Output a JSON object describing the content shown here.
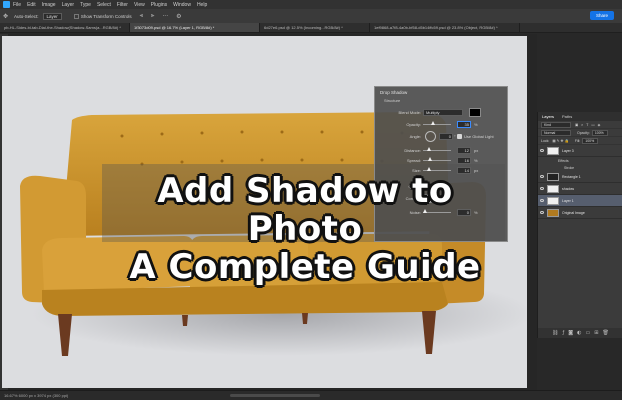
{
  "menubar": {
    "items": [
      "File",
      "Edit",
      "Image",
      "Layer",
      "Type",
      "Select",
      "Filter",
      "View",
      "Plugins",
      "Window",
      "Help"
    ]
  },
  "options": {
    "auto_select_label": "Auto-Select:",
    "auto_select_value": "Layer",
    "transform_label": "Show Transform Controls",
    "share_label": "Share"
  },
  "tabs": [
    {
      "label": "pb-HL-Sides-bl-tab-Dial-the-Shadow(Shadow-Sams)a...RGB/8#) *"
    },
    {
      "label": "1f3073d09.psd @ 16.7% (Layer 1, RGB/8#) *"
    },
    {
      "label": "6d27e6.psd @ 12.5% (Incoming...RGB/8#) *"
    },
    {
      "label": "1ef9868-a7f8-4a0b-bf58-d5b14ffc59.psd @ 23.8% (Object, RGB/8#) *"
    }
  ],
  "headline": {
    "line1": "Add Shadow to Photo",
    "line2": "A Complete Guide"
  },
  "drop_shadow": {
    "title": "Drop Shadow",
    "section": "Structure",
    "blend_mode_label": "Blend Mode:",
    "blend_mode_value": "Multiply",
    "opacity_label": "Opacity:",
    "opacity_value": "35",
    "opacity_unit": "%",
    "angle_label": "Angle:",
    "angle_value": "0",
    "angle_unit": "°",
    "global_light_label": "Use Global Light",
    "distance_label": "Distance:",
    "distance_value": "12",
    "distance_unit": "px",
    "spread_label": "Spread:",
    "spread_value": "16",
    "spread_unit": "%",
    "size_label": "Size:",
    "size_value": "14",
    "size_unit": "px",
    "quality_label": "Quality",
    "contour_label": "Contour:",
    "noise_label": "Noise:",
    "noise_value": "0",
    "noise_unit": "%"
  },
  "layers": {
    "tabs": [
      "Layers",
      "Paths"
    ],
    "kind_label": "Kind",
    "blend_value": "Normal",
    "opacity_label": "Opacity:",
    "opacity_value": "100%",
    "lock_label": "Lock:",
    "fill_label": "Fill:",
    "fill_value": "100%",
    "items": [
      {
        "name": "Layer 3",
        "thumb": "white",
        "sub": [
          "Effects",
          "Stroke"
        ]
      },
      {
        "name": "Rectangle 1",
        "thumb": "dark",
        "sub": []
      },
      {
        "name": "shadow",
        "thumb": "white",
        "sub": []
      },
      {
        "name": "Layer 1",
        "thumb": "white",
        "sub": []
      },
      {
        "name": "Original Image",
        "thumb": "sofa",
        "sub": []
      }
    ],
    "footer_icons": [
      "link-icon",
      "fx-icon",
      "mask-icon",
      "adjust-icon",
      "folder-icon",
      "new-layer-icon",
      "trash-icon"
    ]
  },
  "status": {
    "zoom_text": "16.67%   6000 px x 3974 px (300 ppi)"
  },
  "colors": {
    "accent": "#1473e6",
    "sofa": "#c9922a",
    "canvas_bg": "#dcdde0"
  }
}
